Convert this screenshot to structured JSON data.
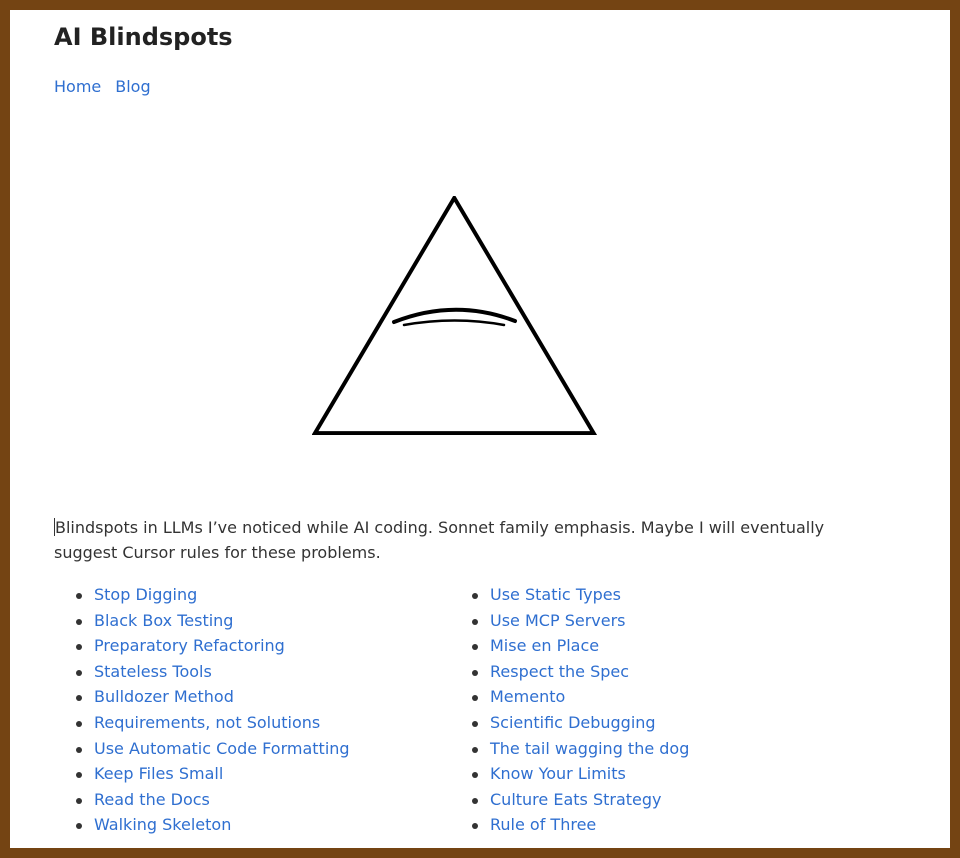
{
  "site": {
    "title": "AI Blindspots"
  },
  "nav": {
    "items": [
      {
        "label": "Home"
      },
      {
        "label": "Blog"
      }
    ]
  },
  "logo": {
    "icon": "triangle-eye-icon",
    "stroke_color": "#000000"
  },
  "intro": {
    "text": "Blindspots in LLMs I’ve noticed while AI coding. Sonnet family emphasis. Maybe I will eventually suggest Cursor rules for these problems."
  },
  "posts": [
    {
      "label": "Stop Digging"
    },
    {
      "label": "Black Box Testing"
    },
    {
      "label": "Preparatory Refactoring"
    },
    {
      "label": "Stateless Tools"
    },
    {
      "label": "Bulldozer Method"
    },
    {
      "label": "Requirements, not Solutions"
    },
    {
      "label": "Use Automatic Code Formatting"
    },
    {
      "label": "Keep Files Small"
    },
    {
      "label": "Read the Docs"
    },
    {
      "label": "Walking Skeleton"
    },
    {
      "label": "Use Static Types"
    },
    {
      "label": "Use MCP Servers"
    },
    {
      "label": "Mise en Place"
    },
    {
      "label": "Respect the Spec"
    },
    {
      "label": "Memento"
    },
    {
      "label": "Scientific Debugging"
    },
    {
      "label": "The tail wagging the dog"
    },
    {
      "label": "Know Your Limits"
    },
    {
      "label": "Culture Eats Strategy"
    },
    {
      "label": "Rule of Three"
    }
  ],
  "colors": {
    "frame": "#744413",
    "link": "#2f6fd0",
    "text": "#333333",
    "title": "#222222"
  }
}
